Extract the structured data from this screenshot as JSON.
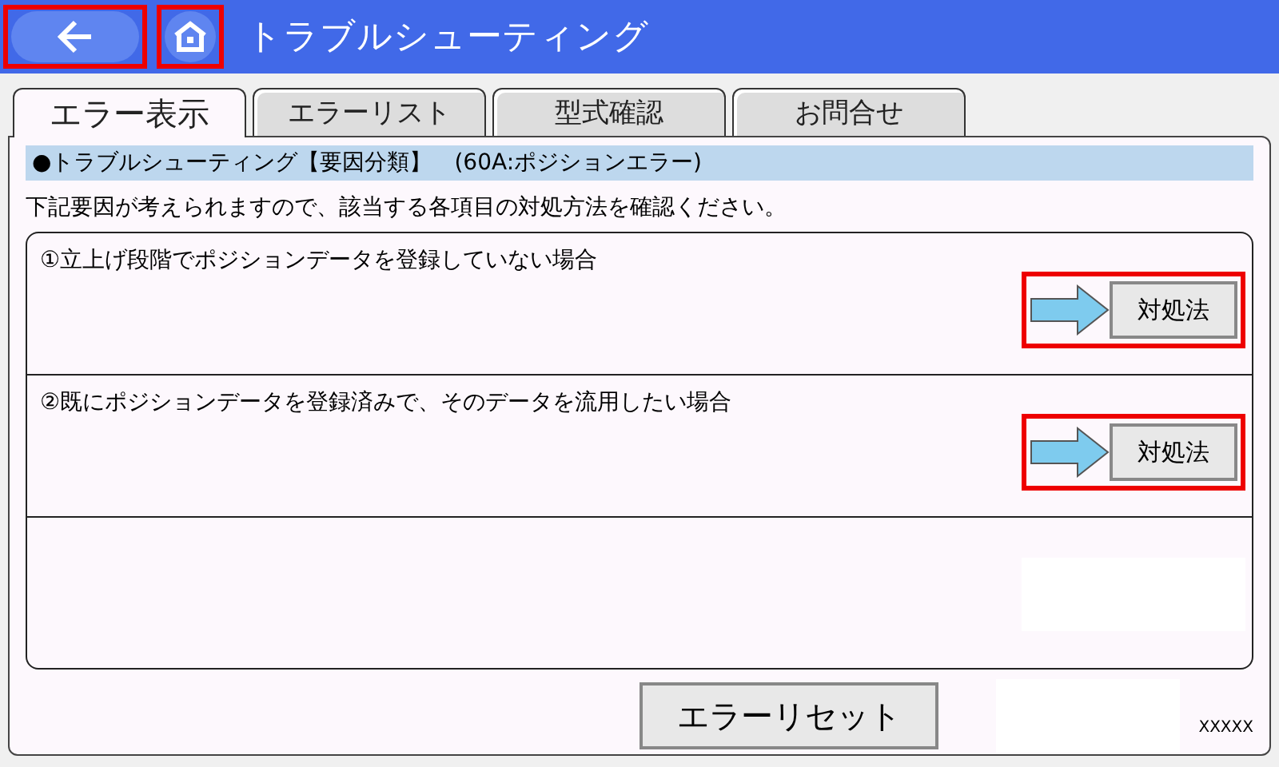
{
  "header": {
    "title": "トラブルシューティング",
    "back_highlighted": true,
    "home_highlighted": true
  },
  "tabs": [
    {
      "label": "エラー表示",
      "selected": true
    },
    {
      "label": "エラーリスト",
      "selected": false
    },
    {
      "label": "型式確認",
      "selected": false
    },
    {
      "label": "お問合せ",
      "selected": false
    }
  ],
  "banner": "●トラブルシューティング【要因分類】　(60A:ポジションエラー)",
  "instruction": "下記要因が考えられますので、該当する各項目の対処方法を確認ください。",
  "causes": [
    {
      "text": "①立上げ段階でポジションデータを登録していない場合",
      "button": "対処法",
      "highlighted": true
    },
    {
      "text": "②既にポジションデータを登録済みで、そのデータを流用したい場合",
      "button": "対処法",
      "highlighted": true
    }
  ],
  "reset_button": "エラーリセット",
  "footer_code": "XXXXX"
}
